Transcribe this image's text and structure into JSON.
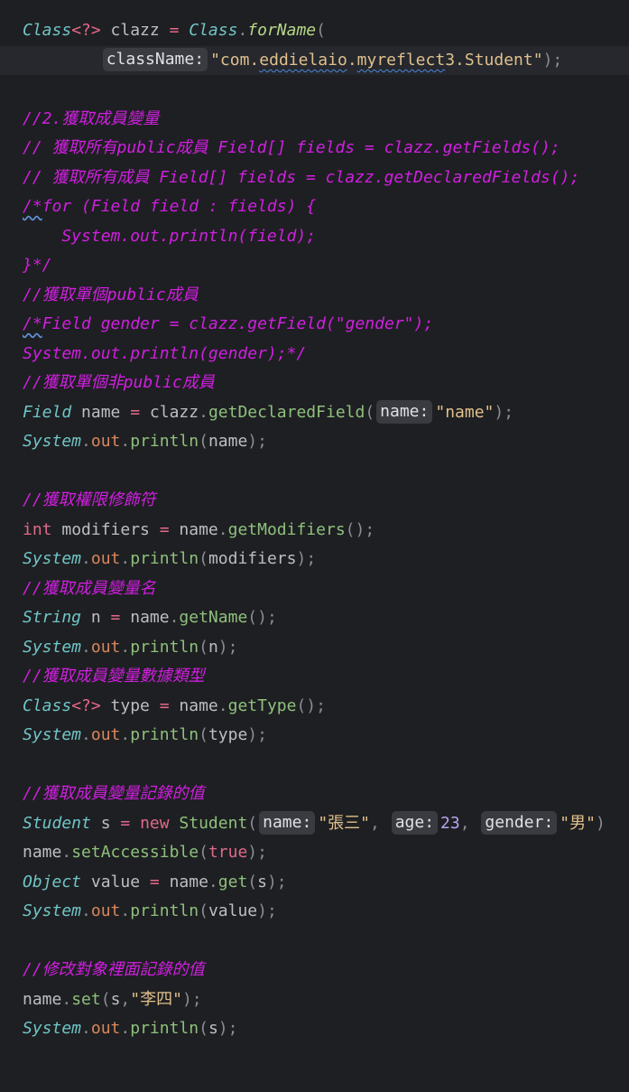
{
  "colors": {
    "background": "#1e1f22",
    "caret_line": "#26282e",
    "type": "#6fc5c8",
    "comment": "#d01fe0",
    "string": "#e0c08c",
    "method": "#8ec07c",
    "field": "#d9865c",
    "keyword": "#e0698a",
    "number": "#b8a4f0",
    "hint_bg": "#393b40"
  },
  "lines": [
    {
      "caret": false,
      "tokens": [
        {
          "t": "Class",
          "k": "type"
        },
        {
          "t": "<?>",
          "k": "op"
        },
        {
          "t": " clazz ",
          "k": "var"
        },
        {
          "t": "=",
          "k": "op"
        },
        {
          "t": " ",
          "k": "var"
        },
        {
          "t": "Class",
          "k": "type"
        },
        {
          "t": ".",
          "k": "punct"
        },
        {
          "t": "forName",
          "k": "static-method"
        },
        {
          "t": "(",
          "k": "punct"
        }
      ]
    },
    {
      "caret": true,
      "tokens": [
        {
          "t": "        ",
          "k": "var"
        },
        {
          "t": "className:",
          "k": "hint"
        },
        {
          "t": "\"com.",
          "k": "string"
        },
        {
          "t": "eddielaio",
          "k": "string-wavy"
        },
        {
          "t": ".",
          "k": "string"
        },
        {
          "t": "myreflect",
          "k": "string-wavy"
        },
        {
          "t": "3.Student\"",
          "k": "string"
        },
        {
          "t": ");",
          "k": "punct"
        }
      ]
    },
    {
      "caret": false,
      "tokens": []
    },
    {
      "caret": false,
      "tokens": [
        {
          "t": "//2.獲取成員變量",
          "k": "comment"
        }
      ]
    },
    {
      "caret": false,
      "tokens": [
        {
          "t": "// 獲取所有public成員 Field[] fields = clazz.getFields();",
          "k": "comment"
        }
      ]
    },
    {
      "caret": false,
      "tokens": [
        {
          "t": "// 獲取所有成員 Field[] fields = clazz.getDeclaredFields();",
          "k": "comment"
        }
      ]
    },
    {
      "caret": false,
      "tokens": [
        {
          "t": "/*",
          "k": "comment-wavy"
        },
        {
          "t": "for (Field field : fields) {",
          "k": "comment"
        }
      ]
    },
    {
      "caret": false,
      "tokens": [
        {
          "t": "    System.out.println(field);",
          "k": "comment"
        }
      ]
    },
    {
      "caret": false,
      "tokens": [
        {
          "t": "}*/",
          "k": "comment"
        }
      ]
    },
    {
      "caret": false,
      "tokens": [
        {
          "t": "//獲取單個public成員",
          "k": "comment"
        }
      ]
    },
    {
      "caret": false,
      "tokens": [
        {
          "t": "/*",
          "k": "comment-wavy"
        },
        {
          "t": "Field gender = clazz.getField(\"gender\");",
          "k": "comment"
        }
      ]
    },
    {
      "caret": false,
      "tokens": [
        {
          "t": "System.out.println(gender);*/",
          "k": "comment"
        }
      ]
    },
    {
      "caret": false,
      "tokens": [
        {
          "t": "//獲取單個非public成員",
          "k": "comment"
        }
      ]
    },
    {
      "caret": false,
      "tokens": [
        {
          "t": "Field",
          "k": "type"
        },
        {
          "t": " name ",
          "k": "var"
        },
        {
          "t": "=",
          "k": "op"
        },
        {
          "t": " clazz",
          "k": "var"
        },
        {
          "t": ".",
          "k": "punct"
        },
        {
          "t": "getDeclaredField",
          "k": "method"
        },
        {
          "t": "(",
          "k": "punct"
        },
        {
          "t": "name:",
          "k": "hint"
        },
        {
          "t": "\"name\"",
          "k": "string"
        },
        {
          "t": ");",
          "k": "punct"
        }
      ]
    },
    {
      "caret": false,
      "tokens": [
        {
          "t": "System",
          "k": "type"
        },
        {
          "t": ".",
          "k": "punct"
        },
        {
          "t": "out",
          "k": "field"
        },
        {
          "t": ".",
          "k": "punct"
        },
        {
          "t": "println",
          "k": "method"
        },
        {
          "t": "(",
          "k": "punct"
        },
        {
          "t": "name",
          "k": "var"
        },
        {
          "t": ");",
          "k": "punct"
        }
      ]
    },
    {
      "caret": false,
      "tokens": []
    },
    {
      "caret": false,
      "tokens": [
        {
          "t": "//獲取權限修飾符",
          "k": "comment"
        }
      ]
    },
    {
      "caret": false,
      "tokens": [
        {
          "t": "int",
          "k": "keyword"
        },
        {
          "t": " modifiers ",
          "k": "var"
        },
        {
          "t": "=",
          "k": "op"
        },
        {
          "t": " name",
          "k": "var"
        },
        {
          "t": ".",
          "k": "punct"
        },
        {
          "t": "getModifiers",
          "k": "method"
        },
        {
          "t": "();",
          "k": "punct"
        }
      ]
    },
    {
      "caret": false,
      "tokens": [
        {
          "t": "System",
          "k": "type"
        },
        {
          "t": ".",
          "k": "punct"
        },
        {
          "t": "out",
          "k": "field"
        },
        {
          "t": ".",
          "k": "punct"
        },
        {
          "t": "println",
          "k": "method"
        },
        {
          "t": "(",
          "k": "punct"
        },
        {
          "t": "modifiers",
          "k": "var"
        },
        {
          "t": ");",
          "k": "punct"
        }
      ]
    },
    {
      "caret": false,
      "tokens": [
        {
          "t": "//獲取成員變量名",
          "k": "comment"
        }
      ]
    },
    {
      "caret": false,
      "tokens": [
        {
          "t": "String",
          "k": "type"
        },
        {
          "t": " n ",
          "k": "var"
        },
        {
          "t": "=",
          "k": "op"
        },
        {
          "t": " name",
          "k": "var"
        },
        {
          "t": ".",
          "k": "punct"
        },
        {
          "t": "getName",
          "k": "method"
        },
        {
          "t": "();",
          "k": "punct"
        }
      ]
    },
    {
      "caret": false,
      "tokens": [
        {
          "t": "System",
          "k": "type"
        },
        {
          "t": ".",
          "k": "punct"
        },
        {
          "t": "out",
          "k": "field"
        },
        {
          "t": ".",
          "k": "punct"
        },
        {
          "t": "println",
          "k": "method"
        },
        {
          "t": "(",
          "k": "punct"
        },
        {
          "t": "n",
          "k": "var"
        },
        {
          "t": ");",
          "k": "punct"
        }
      ]
    },
    {
      "caret": false,
      "tokens": [
        {
          "t": "//獲取成員變量數據類型",
          "k": "comment"
        }
      ]
    },
    {
      "caret": false,
      "tokens": [
        {
          "t": "Class",
          "k": "type"
        },
        {
          "t": "<?>",
          "k": "op"
        },
        {
          "t": " type ",
          "k": "var"
        },
        {
          "t": "=",
          "k": "op"
        },
        {
          "t": " name",
          "k": "var"
        },
        {
          "t": ".",
          "k": "punct"
        },
        {
          "t": "getType",
          "k": "method"
        },
        {
          "t": "();",
          "k": "punct"
        }
      ]
    },
    {
      "caret": false,
      "tokens": [
        {
          "t": "System",
          "k": "type"
        },
        {
          "t": ".",
          "k": "punct"
        },
        {
          "t": "out",
          "k": "field"
        },
        {
          "t": ".",
          "k": "punct"
        },
        {
          "t": "println",
          "k": "method"
        },
        {
          "t": "(",
          "k": "punct"
        },
        {
          "t": "type",
          "k": "var"
        },
        {
          "t": ");",
          "k": "punct"
        }
      ]
    },
    {
      "caret": false,
      "tokens": []
    },
    {
      "caret": false,
      "tokens": [
        {
          "t": "//獲取成員變量記錄的值",
          "k": "comment"
        }
      ]
    },
    {
      "caret": false,
      "tokens": [
        {
          "t": "Student",
          "k": "type"
        },
        {
          "t": " s ",
          "k": "var"
        },
        {
          "t": "=",
          "k": "op"
        },
        {
          "t": " ",
          "k": "var"
        },
        {
          "t": "new",
          "k": "keyword"
        },
        {
          "t": " ",
          "k": "var"
        },
        {
          "t": "Student",
          "k": "method"
        },
        {
          "t": "(",
          "k": "punct"
        },
        {
          "t": "name:",
          "k": "hint"
        },
        {
          "t": "\"張三\"",
          "k": "string"
        },
        {
          "t": ", ",
          "k": "punct"
        },
        {
          "t": "age:",
          "k": "hint"
        },
        {
          "t": "23",
          "k": "number"
        },
        {
          "t": ", ",
          "k": "punct"
        },
        {
          "t": "gender:",
          "k": "hint"
        },
        {
          "t": "\"男\"",
          "k": "string"
        },
        {
          "t": ")",
          "k": "punct"
        }
      ]
    },
    {
      "caret": false,
      "tokens": [
        {
          "t": "name",
          "k": "var"
        },
        {
          "t": ".",
          "k": "punct"
        },
        {
          "t": "setAccessible",
          "k": "method"
        },
        {
          "t": "(",
          "k": "punct"
        },
        {
          "t": "true",
          "k": "keyword"
        },
        {
          "t": ");",
          "k": "punct"
        }
      ]
    },
    {
      "caret": false,
      "tokens": [
        {
          "t": "Object",
          "k": "type"
        },
        {
          "t": " value ",
          "k": "var"
        },
        {
          "t": "=",
          "k": "op"
        },
        {
          "t": " name",
          "k": "var"
        },
        {
          "t": ".",
          "k": "punct"
        },
        {
          "t": "get",
          "k": "method"
        },
        {
          "t": "(",
          "k": "punct"
        },
        {
          "t": "s",
          "k": "var"
        },
        {
          "t": ");",
          "k": "punct"
        }
      ]
    },
    {
      "caret": false,
      "tokens": [
        {
          "t": "System",
          "k": "type"
        },
        {
          "t": ".",
          "k": "punct"
        },
        {
          "t": "out",
          "k": "field"
        },
        {
          "t": ".",
          "k": "punct"
        },
        {
          "t": "println",
          "k": "method"
        },
        {
          "t": "(",
          "k": "punct"
        },
        {
          "t": "value",
          "k": "var"
        },
        {
          "t": ");",
          "k": "punct"
        }
      ]
    },
    {
      "caret": false,
      "tokens": []
    },
    {
      "caret": false,
      "tokens": [
        {
          "t": "//修改對象裡面記錄的值",
          "k": "comment"
        }
      ]
    },
    {
      "caret": false,
      "tokens": [
        {
          "t": "name",
          "k": "var"
        },
        {
          "t": ".",
          "k": "punct"
        },
        {
          "t": "set",
          "k": "method"
        },
        {
          "t": "(",
          "k": "punct"
        },
        {
          "t": "s",
          "k": "var"
        },
        {
          "t": ",",
          "k": "punct"
        },
        {
          "t": "\"李四\"",
          "k": "string"
        },
        {
          "t": ");",
          "k": "punct"
        }
      ]
    },
    {
      "caret": false,
      "tokens": [
        {
          "t": "System",
          "k": "type"
        },
        {
          "t": ".",
          "k": "punct"
        },
        {
          "t": "out",
          "k": "field"
        },
        {
          "t": ".",
          "k": "punct"
        },
        {
          "t": "println",
          "k": "method"
        },
        {
          "t": "(",
          "k": "punct"
        },
        {
          "t": "s",
          "k": "var"
        },
        {
          "t": ");",
          "k": "punct"
        }
      ]
    }
  ]
}
